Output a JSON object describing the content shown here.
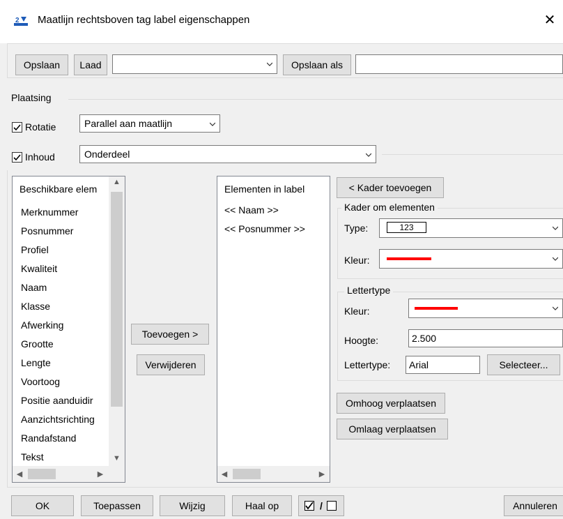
{
  "window": {
    "title": "Maatlijn rechtsboven tag label eigenschappen"
  },
  "toolbar": {
    "save_label": "Opslaan",
    "load_label": "Laad",
    "preset_value": "",
    "save_as_label": "Opslaan als",
    "save_as_value": ""
  },
  "placement": {
    "group_label": "Plaatsing",
    "rotation_label": "Rotatie",
    "rotation_value": "Parallel aan maatlijn",
    "content_label": "Inhoud",
    "content_value": "Onderdeel"
  },
  "available": {
    "header": "Beschikbare elem",
    "items": [
      "Merknummer",
      "Posnummer",
      "Profiel",
      "Kwaliteit",
      "Naam",
      "Klasse",
      "Afwerking",
      "Grootte",
      "Lengte",
      "Voortoog",
      "Positie aanduidir",
      "Aanzichtsrichting",
      "Randafstand",
      "Tekst"
    ]
  },
  "transfer": {
    "add_label": "Toevoegen >",
    "remove_label": "Verwijderen"
  },
  "in_label": {
    "header": "Elementen in label",
    "items": [
      "<< Naam >>",
      "<< Posnummer >>"
    ]
  },
  "frame": {
    "add_button": "< Kader toevoegen",
    "group_label": "Kader om elementen",
    "type_label": "Type:",
    "type_value": "123",
    "color_label": "Kleur:",
    "color": "#ff0000"
  },
  "font": {
    "group_label": "Lettertype",
    "color_label": "Kleur:",
    "color": "#ff0000",
    "height_label": "Hoogte:",
    "height_value": "2.500",
    "font_label": "Lettertype:",
    "font_value": "Arial",
    "select_button": "Selecteer..."
  },
  "move": {
    "up_label": "Omhoog verplaatsen",
    "down_label": "Omlaag verplaatsen"
  },
  "footer": {
    "ok_label": "OK",
    "apply_label": "Toepassen",
    "modify_label": "Wijzig",
    "get_label": "Haal op",
    "toggle_separator": "/",
    "cancel_label": "Annuleren"
  }
}
